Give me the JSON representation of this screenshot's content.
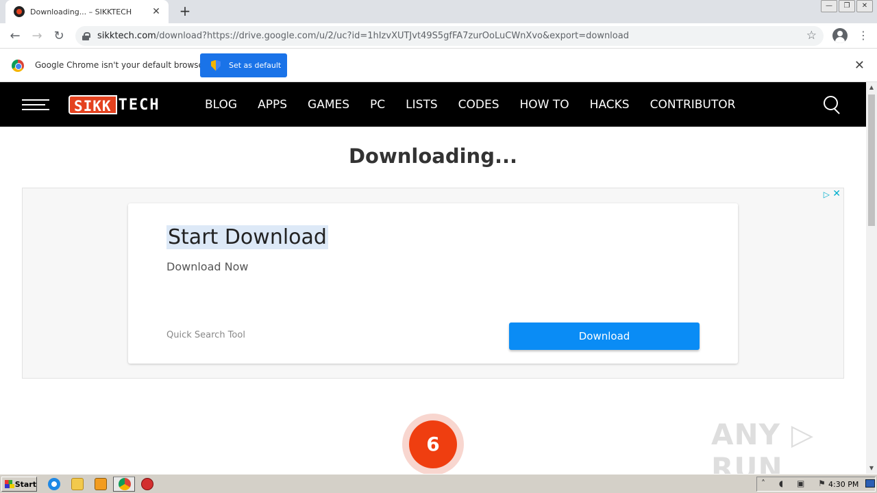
{
  "browser": {
    "tab_title": "Downloading... – SIKKTECH",
    "tab_close": "✕",
    "new_tab": "+",
    "url_host": "sikktech.com",
    "url_path": "/download?https://drive.google.com/u/2/uc?id=1hIzvXUTJvt49S5gfFA7zurOoLuCWnXvo&export=download",
    "window_minimize": "—",
    "window_restore": "❐",
    "window_close": "✕",
    "back": "←",
    "forward": "→",
    "reload": "↻",
    "star": "☆",
    "menu": "⋮"
  },
  "infobar": {
    "message": "Google Chrome isn't your default browser",
    "button_label": "Set as default",
    "close": "✕"
  },
  "site": {
    "logo_part1": "SIKK",
    "logo_part2": "TECH",
    "nav": [
      "BLOG",
      "APPS",
      "GAMES",
      "PC",
      "LISTS",
      "CODES",
      "HOW TO",
      "HACKS",
      "CONTRIBUTOR"
    ]
  },
  "page": {
    "title": "Downloading..."
  },
  "ad": {
    "adchoices": "▷",
    "close": "✕",
    "headline": "Start Download",
    "subline": "Download Now",
    "source": "Quick Search Tool",
    "button_label": "Download"
  },
  "countdown": {
    "value": "6"
  },
  "watermark": "ANY ▷ RUN",
  "taskbar": {
    "start_label": "Start",
    "clock": "4:30 PM"
  },
  "colors": {
    "site_accent": "#e4421f",
    "chrome_blue": "#1a73e8",
    "ad_button": "#0a8cf5"
  }
}
